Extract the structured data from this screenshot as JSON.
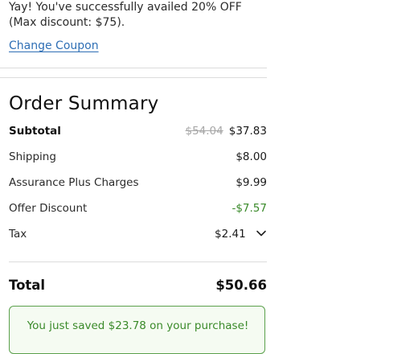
{
  "coupon": {
    "message_line1": "Yay! You've successfully availed 20% OFF",
    "message_line2": "(Max discount: $75).",
    "change_label": "Change Coupon"
  },
  "summary": {
    "title": "Order Summary",
    "subtotal": {
      "label": "Subtotal",
      "original_price": "$54.04",
      "price": "$37.83"
    },
    "shipping": {
      "label": "Shipping",
      "value": "$8.00"
    },
    "assurance": {
      "label": "Assurance Plus Charges",
      "value": "$9.99"
    },
    "offer_discount": {
      "label": "Offer Discount",
      "value": "-$7.57"
    },
    "tax": {
      "label": "Tax",
      "value": "$2.41",
      "icon": "chevron-down-icon"
    },
    "total": {
      "label": "Total",
      "value": "$50.66"
    },
    "savings_message": "You just saved $23.78 on your purchase!"
  },
  "colors": {
    "link": "#2f6fb5",
    "discount": "#3a8a2a",
    "savings_border": "#5aa04b",
    "strikethrough": "#a7a7a7"
  }
}
